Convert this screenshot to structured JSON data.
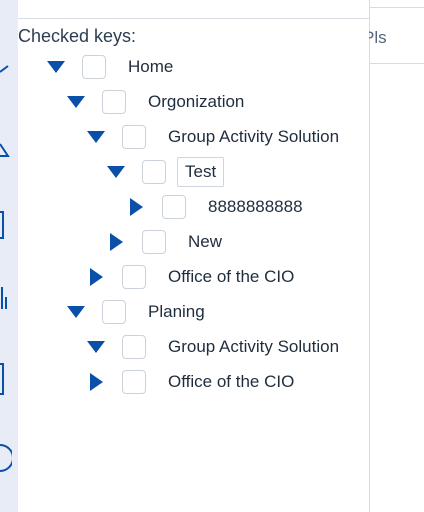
{
  "colors": {
    "accent": "#0a4fa8",
    "rail": "#e8ecf6",
    "border": "#d7dbe3"
  },
  "header": {
    "checked_keys_label": "Checked keys:"
  },
  "right_pane": {
    "text": "Pls"
  },
  "tree": [
    {
      "label": "Home",
      "expanded": true,
      "level": 0,
      "checked": false
    },
    {
      "label": "Orgonization",
      "expanded": true,
      "level": 1,
      "checked": false
    },
    {
      "label": "Group Activity Solution",
      "expanded": true,
      "level": 2,
      "checked": false
    },
    {
      "label": "Test",
      "expanded": true,
      "level": 3,
      "checked": false,
      "selected": true
    },
    {
      "label": "8888888888",
      "expanded": false,
      "level": 4,
      "checked": false
    },
    {
      "label": "New",
      "expanded": false,
      "level": 3,
      "checked": false
    },
    {
      "label": "Office of the CIO",
      "expanded": false,
      "level": 2,
      "checked": false
    },
    {
      "label": "Planing",
      "expanded": true,
      "level": 1,
      "checked": false
    },
    {
      "label": "Group Activity Solution",
      "expanded": true,
      "level": 2,
      "checked": false
    },
    {
      "label": "Office of the CIO",
      "expanded": false,
      "level": 2,
      "checked": false
    }
  ]
}
